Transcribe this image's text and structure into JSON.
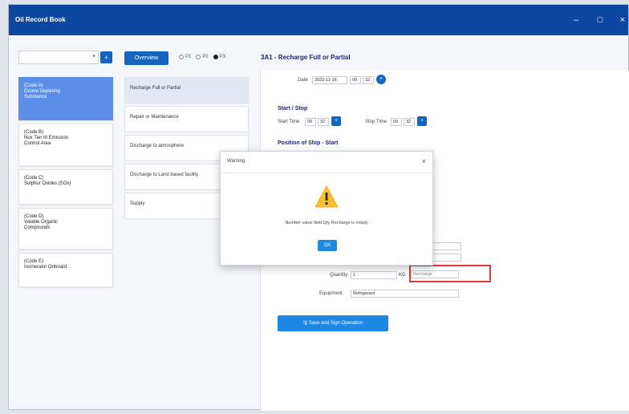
{
  "app": {
    "title": "Oil Record Book",
    "window_controls": {
      "minimize": "–",
      "maximize": "□",
      "close": "×"
    }
  },
  "toolbar": {
    "search_value": "",
    "dropdown_icon": "chevron-down-icon",
    "add_button_icon": "plus-icon",
    "overview_label": "Overview",
    "radios": [
      {
        "label": "P1",
        "selected": false
      },
      {
        "label": "P2",
        "selected": false
      },
      {
        "label": "P3",
        "selected": true
      }
    ]
  },
  "page_title": "3A1 - Recharge Full or Partial",
  "categories": [
    {
      "code": "(Code A)",
      "name_line1": "Ozone Depleting",
      "name_line2": "Substance",
      "active": true
    },
    {
      "code": "(Code B)",
      "name_line1": "Nox Tier III Emission",
      "name_line2": "Control Area",
      "active": false
    },
    {
      "code": "(Code C)",
      "name_line1": "Sulphur Oxides (SOx)",
      "name_line2": "",
      "active": false
    },
    {
      "code": "(Code D)",
      "name_line1": "Volatile Organic",
      "name_line2": "Compounds",
      "active": false
    },
    {
      "code": "(Code E)",
      "name_line1": "Incinerator Onboard",
      "name_line2": "",
      "active": false
    }
  ],
  "operations": [
    {
      "label": "Recharge Full or Partial",
      "active": true
    },
    {
      "label": "Repair or Maintenance",
      "active": false
    },
    {
      "label": "Discharge to atmosphere",
      "active": false
    },
    {
      "label": "Discharge to Land based facility",
      "active": false
    },
    {
      "label": "Supply",
      "active": false
    }
  ],
  "form": {
    "date_label": "Date",
    "date_value": "2023-11-16",
    "date_hh": "09",
    "date_mm": "32",
    "start_stop_title": "Start / Stop",
    "start_time_label": "Start Time",
    "start_hh": "09",
    "start_mm": "32",
    "stop_time_label": "Stop Time",
    "stop_hh": "09",
    "stop_mm": "32",
    "position_title": "Position of Ship - Start",
    "quantity_label": "Quantity",
    "quantity_value": "1",
    "quantity_unit": "KG",
    "recharge_placeholder": "Recharge",
    "equipment_label": "Equipment",
    "equipment_value": "Refrigerant",
    "save_label": "Save and Sign Operation"
  },
  "modal": {
    "title": "Warning",
    "close": "×",
    "message": "Number value field Qty Recharge is empty",
    "ok_label": "OK"
  },
  "colors": {
    "titlebar": "#0d47a1",
    "primary": "#1565c0",
    "active_category": "#5b8ee6",
    "highlight": "#e53935",
    "warning": "#fbc02d"
  }
}
